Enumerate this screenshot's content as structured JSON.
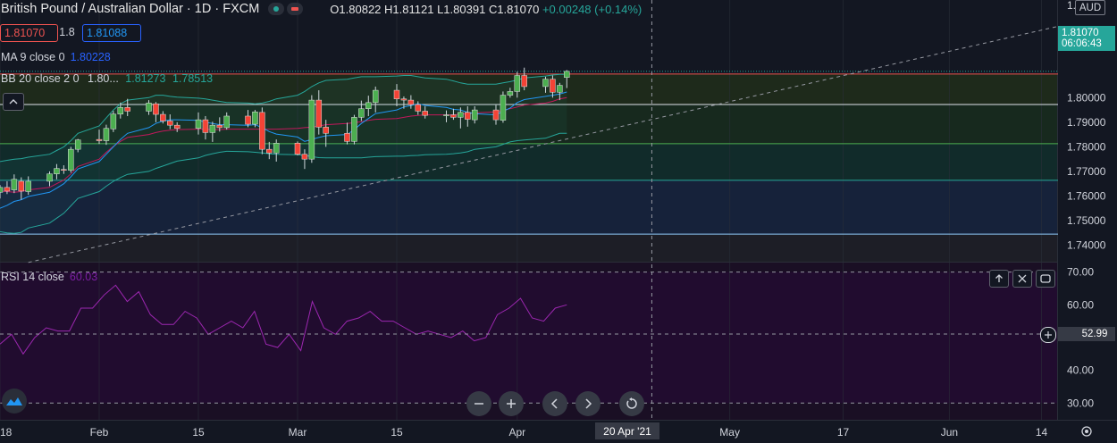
{
  "header": {
    "symbol_title": "British Pound / Australian Dollar · 1D · FXCM",
    "ohlc": {
      "o": "O1.80822",
      "h": "H1.81121",
      "l": "L1.80391",
      "c": "C1.81070",
      "chg": "+0.00248 (+0.14%)"
    },
    "sell_price": "1.81070",
    "spread": "1.8",
    "buy_price": "1.81088"
  },
  "indicators": {
    "ma_label": "MA 9 close 0",
    "ma_value": "1.80228",
    "bb_label": "BB 20 close 2 0",
    "bb_values": [
      "1.80...",
      "1.81273",
      "1.78513"
    ],
    "rsi_label": "RSI 14 close",
    "rsi_value": "60.03"
  },
  "price_axis": {
    "currency": "AUD",
    "last_price": "1.81070",
    "countdown": "06:06:43",
    "top_tick": "1.8"
  },
  "rsi_axis": {
    "current": "52.99"
  },
  "time_axis": {
    "crosshair_date": "20 Apr '21"
  },
  "colors": {
    "up": "#26a69a",
    "down": "#ef5350",
    "up_fill": "#4caf50",
    "down_fill": "#f44336",
    "ma": "#2196f3",
    "bb": "#26a69a",
    "rsi": "#9c27b0"
  },
  "icons": [
    "up-arrow-icon",
    "close-icon",
    "maximize-icon",
    "zoom-out-icon",
    "zoom-in-icon",
    "scroll-left-icon",
    "scroll-right-icon",
    "reset-icon",
    "settings-icon",
    "plus-circle-icon",
    "eye-icon"
  ],
  "chart_data": {
    "type": "candlestick",
    "price_ylim": [
      1.7333,
      1.8397
    ],
    "price_ticks": [
      1.74,
      1.75,
      1.76,
      1.77,
      1.78,
      1.79,
      1.8
    ],
    "rsi_ylim": [
      24.9,
      72.9
    ],
    "rsi_ticks": [
      30.0,
      40.0,
      50.0,
      60.0,
      70.0
    ],
    "rsi_bands": [
      30,
      70
    ],
    "x_labels": [
      "18",
      "Feb",
      "15",
      "Mar",
      "15",
      "Apr",
      "May",
      "17",
      "Jun",
      "14"
    ],
    "horizontal_levels": [
      1.8096,
      1.7972,
      1.7813,
      1.7664,
      1.7445
    ],
    "level_zones": [
      {
        "from": 1.8096,
        "to": 1.7972,
        "color": "#1e2a1b"
      },
      {
        "from": 1.7972,
        "to": 1.7813,
        "color": "#17291e"
      },
      {
        "from": 1.7813,
        "to": 1.7664,
        "color": "#112b2a"
      },
      {
        "from": 1.7664,
        "to": 1.7445,
        "color": "#16223a"
      },
      {
        "from": 1.7445,
        "to": 1.733,
        "color": "#1d1e26"
      }
    ],
    "trend_line": {
      "start": [
        "2021-01-22",
        1.733
      ],
      "end": [
        "2021-07-03",
        1.84
      ]
    },
    "candles": [
      {
        "date": "2021-01-18",
        "o": 1.7615,
        "h": 1.7645,
        "l": 1.759,
        "c": 1.7635
      },
      {
        "date": "2021-01-19",
        "o": 1.7635,
        "h": 1.766,
        "l": 1.7608,
        "c": 1.762
      },
      {
        "date": "2021-01-20",
        "o": 1.7625,
        "h": 1.7688,
        "l": 1.7612,
        "c": 1.7668
      },
      {
        "date": "2021-01-21",
        "o": 1.766,
        "h": 1.7676,
        "l": 1.7585,
        "c": 1.762
      },
      {
        "date": "2021-01-22",
        "o": 1.7618,
        "h": 1.768,
        "l": 1.7605,
        "c": 1.766
      },
      {
        "date": "2021-01-25",
        "o": 1.766,
        "h": 1.77,
        "l": 1.764,
        "c": 1.769
      },
      {
        "date": "2021-01-26",
        "o": 1.769,
        "h": 1.773,
        "l": 1.7668,
        "c": 1.7712
      },
      {
        "date": "2021-01-27",
        "o": 1.7708,
        "h": 1.7725,
        "l": 1.769,
        "c": 1.7705
      },
      {
        "date": "2021-01-28",
        "o": 1.7705,
        "h": 1.78,
        "l": 1.7695,
        "c": 1.779
      },
      {
        "date": "2021-01-29",
        "o": 1.779,
        "h": 1.7832,
        "l": 1.7778,
        "c": 1.7828
      },
      {
        "date": "2021-02-01",
        "o": 1.783,
        "h": 1.787,
        "l": 1.7812,
        "c": 1.7825
      },
      {
        "date": "2021-02-02",
        "o": 1.7825,
        "h": 1.789,
        "l": 1.7808,
        "c": 1.7875
      },
      {
        "date": "2021-02-03",
        "o": 1.7873,
        "h": 1.7946,
        "l": 1.786,
        "c": 1.7933
      },
      {
        "date": "2021-02-04",
        "o": 1.7933,
        "h": 1.798,
        "l": 1.7915,
        "c": 1.796
      },
      {
        "date": "2021-02-05",
        "o": 1.796,
        "h": 1.7995,
        "l": 1.7925,
        "c": 1.7945
      },
      {
        "date": "2021-02-08",
        "o": 1.7945,
        "h": 1.799,
        "l": 1.793,
        "c": 1.7978
      },
      {
        "date": "2021-02-09",
        "o": 1.7975,
        "h": 1.7982,
        "l": 1.79,
        "c": 1.7932
      },
      {
        "date": "2021-02-10",
        "o": 1.7932,
        "h": 1.7945,
        "l": 1.7895,
        "c": 1.7905
      },
      {
        "date": "2021-02-11",
        "o": 1.7905,
        "h": 1.7932,
        "l": 1.7872,
        "c": 1.7888
      },
      {
        "date": "2021-02-12",
        "o": 1.7888,
        "h": 1.79,
        "l": 1.786,
        "c": 1.7875
      },
      {
        "date": "2021-02-15",
        "o": 1.7875,
        "h": 1.794,
        "l": 1.785,
        "c": 1.791
      },
      {
        "date": "2021-02-16",
        "o": 1.791,
        "h": 1.7925,
        "l": 1.783,
        "c": 1.7858
      },
      {
        "date": "2021-02-17",
        "o": 1.7858,
        "h": 1.7902,
        "l": 1.782,
        "c": 1.7888
      },
      {
        "date": "2021-02-18",
        "o": 1.7888,
        "h": 1.792,
        "l": 1.7862,
        "c": 1.7878
      },
      {
        "date": "2021-02-19",
        "o": 1.7878,
        "h": 1.794,
        "l": 1.787,
        "c": 1.7925
      },
      {
        "date": "2021-02-22",
        "o": 1.7925,
        "h": 1.795,
        "l": 1.788,
        "c": 1.7892
      },
      {
        "date": "2021-02-23",
        "o": 1.7892,
        "h": 1.795,
        "l": 1.788,
        "c": 1.7942
      },
      {
        "date": "2021-02-24",
        "o": 1.794,
        "h": 1.796,
        "l": 1.777,
        "c": 1.779
      },
      {
        "date": "2021-02-25",
        "o": 1.779,
        "h": 1.782,
        "l": 1.775,
        "c": 1.7775
      },
      {
        "date": "2021-02-26",
        "o": 1.7775,
        "h": 1.783,
        "l": 1.774,
        "c": 1.7815
      },
      {
        "date": "2021-03-01",
        "o": 1.7815,
        "h": 1.7822,
        "l": 1.7765,
        "c": 1.777
      },
      {
        "date": "2021-03-02",
        "o": 1.777,
        "h": 1.779,
        "l": 1.771,
        "c": 1.775
      },
      {
        "date": "2021-03-03",
        "o": 1.775,
        "h": 1.801,
        "l": 1.7735,
        "c": 1.799
      },
      {
        "date": "2021-03-04",
        "o": 1.799,
        "h": 1.803,
        "l": 1.785,
        "c": 1.788
      },
      {
        "date": "2021-03-05",
        "o": 1.788,
        "h": 1.791,
        "l": 1.78,
        "c": 1.7855
      },
      {
        "date": "2021-03-08",
        "o": 1.7855,
        "h": 1.7898,
        "l": 1.781,
        "c": 1.7822
      },
      {
        "date": "2021-03-09",
        "o": 1.7822,
        "h": 1.793,
        "l": 1.781,
        "c": 1.792
      },
      {
        "date": "2021-03-10",
        "o": 1.792,
        "h": 1.7988,
        "l": 1.7905,
        "c": 1.7955
      },
      {
        "date": "2021-03-11",
        "o": 1.7955,
        "h": 1.8008,
        "l": 1.7925,
        "c": 1.798
      },
      {
        "date": "2021-03-12",
        "o": 1.798,
        "h": 1.8045,
        "l": 1.794,
        "c": 1.803
      },
      {
        "date": "2021-03-15",
        "o": 1.803,
        "h": 1.8055,
        "l": 1.7965,
        "c": 1.7995
      },
      {
        "date": "2021-03-16",
        "o": 1.7995,
        "h": 1.8005,
        "l": 1.7955,
        "c": 1.799
      },
      {
        "date": "2021-03-17",
        "o": 1.799,
        "h": 1.801,
        "l": 1.7955,
        "c": 1.7972
      },
      {
        "date": "2021-03-18",
        "o": 1.7972,
        "h": 1.7985,
        "l": 1.793,
        "c": 1.7945
      },
      {
        "date": "2021-03-19",
        "o": 1.7945,
        "h": 1.7965,
        "l": 1.7915,
        "c": 1.7928
      },
      {
        "date": "2021-03-22",
        "o": 1.7928,
        "h": 1.7948,
        "l": 1.79,
        "c": 1.793
      },
      {
        "date": "2021-03-23",
        "o": 1.793,
        "h": 1.7955,
        "l": 1.791,
        "c": 1.792
      },
      {
        "date": "2021-03-24",
        "o": 1.792,
        "h": 1.796,
        "l": 1.7875,
        "c": 1.794
      },
      {
        "date": "2021-03-25",
        "o": 1.794,
        "h": 1.7965,
        "l": 1.7882,
        "c": 1.7912
      },
      {
        "date": "2021-03-26",
        "o": 1.791,
        "h": 1.7965,
        "l": 1.7895,
        "c": 1.795
      },
      {
        "date": "2021-03-29",
        "o": 1.795,
        "h": 1.797,
        "l": 1.789,
        "c": 1.791
      },
      {
        "date": "2021-03-30",
        "o": 1.7908,
        "h": 1.8025,
        "l": 1.7898,
        "c": 1.801
      },
      {
        "date": "2021-03-31",
        "o": 1.801,
        "h": 1.804,
        "l": 1.8,
        "c": 1.8025
      },
      {
        "date": "2021-04-01",
        "o": 1.8025,
        "h": 1.8105,
        "l": 1.8,
        "c": 1.809
      },
      {
        "date": "2021-04-02",
        "o": 1.809,
        "h": 1.8122,
        "l": 1.803,
        "c": 1.8045
      },
      {
        "date": "2021-04-05",
        "o": 1.8045,
        "h": 1.8085,
        "l": 1.802,
        "c": 1.8075
      },
      {
        "date": "2021-04-06",
        "o": 1.8075,
        "h": 1.809,
        "l": 1.8,
        "c": 1.8022
      },
      {
        "date": "2021-04-07",
        "o": 1.8022,
        "h": 1.806,
        "l": 1.799,
        "c": 1.805
      },
      {
        "date": "2021-04-08",
        "o": 1.8082,
        "h": 1.8112,
        "l": 1.8039,
        "c": 1.8107
      }
    ],
    "ma_series": [
      1.755,
      1.7562,
      1.7578,
      1.7585,
      1.7598,
      1.7615,
      1.7632,
      1.765,
      1.7678,
      1.771,
      1.774,
      1.777,
      1.78,
      1.783,
      1.7855,
      1.7878,
      1.7895,
      1.7905,
      1.791,
      1.791,
      1.7908,
      1.79,
      1.7895,
      1.789,
      1.789,
      1.7888,
      1.789,
      1.7878,
      1.7862,
      1.7852,
      1.784,
      1.7822,
      1.783,
      1.7838,
      1.7845,
      1.785,
      1.787,
      1.7895,
      1.7915,
      1.7935,
      1.795,
      1.7962,
      1.7968,
      1.7975,
      1.7968,
      1.796,
      1.7952,
      1.795,
      1.794,
      1.7935,
      1.793,
      1.7945,
      1.7958,
      1.798,
      1.7992,
      1.8005,
      1.801,
      1.8015,
      1.8023
    ],
    "bb_upper": [
      1.774,
      1.7745,
      1.775,
      1.7752,
      1.7758,
      1.777,
      1.7785,
      1.78,
      1.7825,
      1.7855,
      1.7885,
      1.7918,
      1.795,
      1.7975,
      1.799,
      1.8,
      1.801,
      1.801,
      1.8005,
      1.8002,
      1.7998,
      1.7995,
      1.799,
      1.7985,
      1.798,
      1.7978,
      1.7975,
      1.7978,
      1.7985,
      1.7995,
      1.801,
      1.8025,
      1.8045,
      1.806,
      1.807,
      1.8075,
      1.808,
      1.8085,
      1.8085,
      1.8085,
      1.8088,
      1.809,
      1.809,
      1.8085,
      1.808,
      1.8075,
      1.8068,
      1.806,
      1.8055,
      1.8055,
      1.8055,
      1.806,
      1.8065,
      1.8072,
      1.808,
      1.8088,
      1.8092,
      1.8095,
      1.8095
    ],
    "bb_lower": [
      1.7455,
      1.745,
      1.7448,
      1.7452,
      1.747,
      1.749,
      1.751,
      1.753,
      1.756,
      1.759,
      1.7618,
      1.764,
      1.766,
      1.7675,
      1.7688,
      1.77,
      1.7712,
      1.7722,
      1.7732,
      1.7742,
      1.7755,
      1.7765,
      1.7772,
      1.7778,
      1.7782,
      1.778,
      1.7778,
      1.7775,
      1.7772,
      1.777,
      1.7768,
      1.7765,
      1.776,
      1.7756,
      1.7755,
      1.7755,
      1.7755,
      1.7755,
      1.7758,
      1.776,
      1.7762,
      1.7762,
      1.7764,
      1.7765,
      1.7768,
      1.777,
      1.7772,
      1.7775,
      1.778,
      1.779,
      1.78,
      1.781,
      1.782,
      1.7825,
      1.7828,
      1.7835,
      1.7845,
      1.7855,
      1.7855
    ],
    "bb_basis": [
      1.762,
      1.7618,
      1.7615,
      1.7618,
      1.7625,
      1.7635,
      1.765,
      1.7665,
      1.769,
      1.772,
      1.775,
      1.7778,
      1.7802,
      1.7822,
      1.7838,
      1.785,
      1.7858,
      1.7864,
      1.7868,
      1.787,
      1.7872,
      1.7872,
      1.787,
      1.787,
      1.7872,
      1.7872,
      1.7872,
      1.7872,
      1.7872,
      1.7872,
      1.7875,
      1.7878,
      1.788,
      1.7885,
      1.789,
      1.7895,
      1.7898,
      1.7902,
      1.7908,
      1.7912,
      1.7915,
      1.792,
      1.7925,
      1.7928,
      1.793,
      1.793,
      1.793,
      1.7932,
      1.7935,
      1.7938,
      1.7942,
      1.7948,
      1.7955,
      1.7962,
      1.797,
      1.7978,
      1.7985,
      1.7995,
      1.8
    ],
    "rsi_series": [
      48,
      51,
      45,
      50,
      53,
      52,
      52,
      59,
      59,
      63,
      66,
      61,
      64,
      57,
      54,
      54,
      58,
      56,
      51,
      53,
      55,
      53,
      58,
      48,
      47,
      51,
      46,
      61,
      53,
      51,
      55,
      56,
      58,
      55,
      55,
      53,
      51,
      52,
      51,
      50,
      52,
      49,
      50,
      57,
      59,
      62,
      56,
      55,
      59,
      60
    ]
  }
}
